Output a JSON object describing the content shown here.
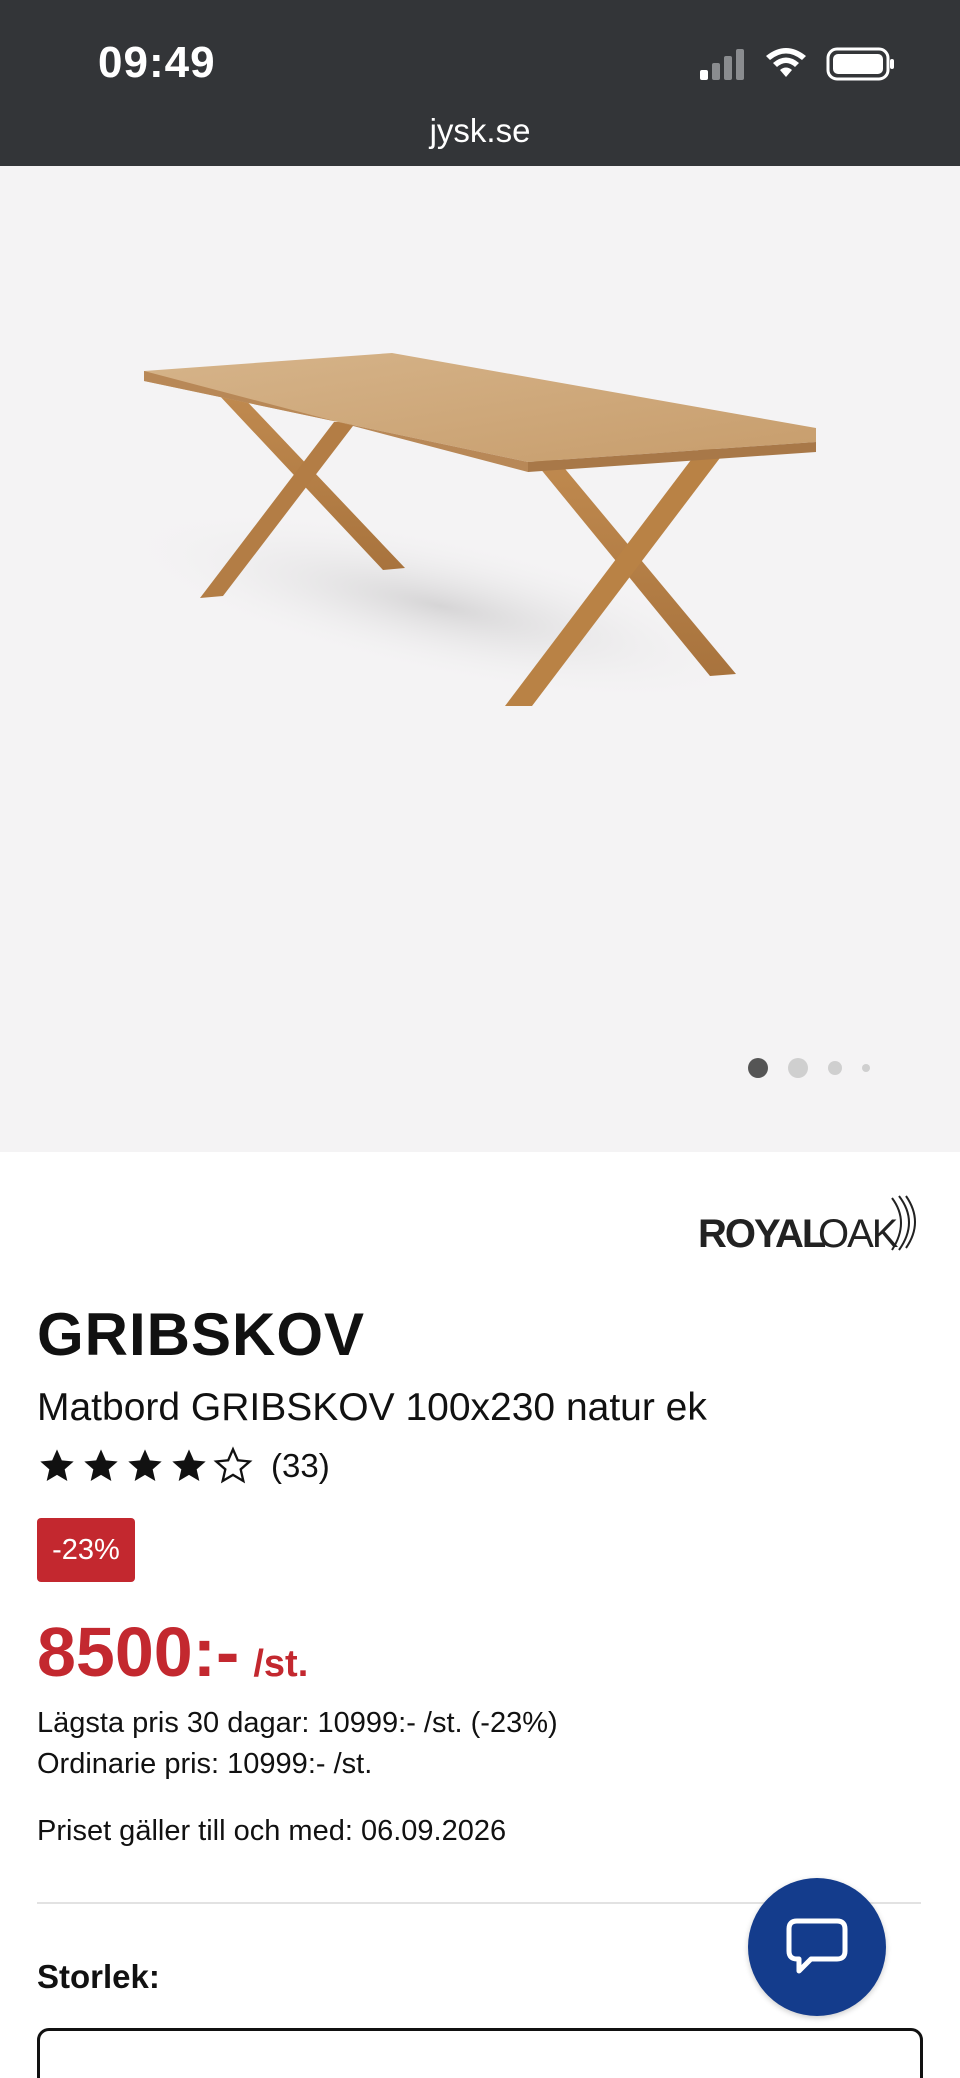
{
  "status_bar": {
    "time": "09:49",
    "url": "jysk.se",
    "icons": [
      "cellular-signal-icon",
      "wifi-icon",
      "battery-icon"
    ]
  },
  "hero": {
    "image": "table-product-photo",
    "carousel_dots": 4,
    "active_dot": 0
  },
  "product": {
    "brand": "ROYAL OAK",
    "name": "GRIBSKOV",
    "description": "Matbord GRIBSKOV 100x230 natur ek",
    "rating_value": 4,
    "rating_max": 5,
    "rating_count": "(33)",
    "discount_badge": "-23%",
    "price": "8500:-",
    "price_unit": "/st.",
    "lowest_price": "Lägsta pris 30 dagar: 10999:- /st. (-23%)",
    "regular_price": "Ordinarie pris: 10999:- /st.",
    "valid_until": "Priset gäller till och med: 06.09.2026",
    "size_label": "Storlek:"
  },
  "colors": {
    "status_bar_bg": "#333538",
    "hero_bg": "#f4f3f4",
    "sale_red": "#c3282f",
    "chat_blue": "#143c8c"
  }
}
